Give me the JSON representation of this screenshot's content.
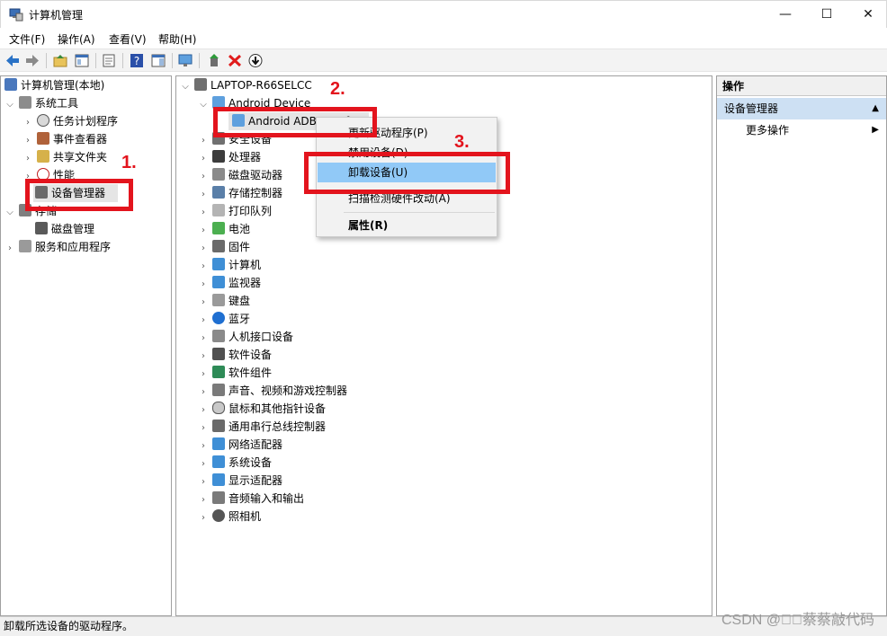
{
  "window": {
    "title": "计算机管理",
    "min_glyph": "—",
    "max_glyph": "☐",
    "close_glyph": "✕"
  },
  "menu": {
    "file": "文件(F)",
    "action": "操作(A)",
    "view": "查看(V)",
    "help": "帮助(H)"
  },
  "left_tree": {
    "root": "计算机管理(本地)",
    "system_tools": "系统工具",
    "task_scheduler": "任务计划程序",
    "event_viewer": "事件查看器",
    "shared_folders": "共享文件夹",
    "performance": "性能",
    "device_manager": "设备管理器",
    "storage": "存储",
    "disk_management": "磁盘管理",
    "services_apps": "服务和应用程序"
  },
  "device_tree": {
    "computer": "LAPTOP-R66SELCC",
    "android_device": "Android Device",
    "adb_interface": "Android ADB Interface",
    "categories": [
      "安全设备",
      "处理器",
      "磁盘驱动器",
      "存储控制器",
      "打印队列",
      "电池",
      "固件",
      "计算机",
      "监视器",
      "键盘",
      "蓝牙",
      "人机接口设备",
      "软件设备",
      "软件组件",
      "声音、视频和游戏控制器",
      "鼠标和其他指针设备",
      "通用串行总线控制器",
      "网络适配器",
      "系统设备",
      "显示适配器",
      "音频输入和输出",
      "照相机"
    ]
  },
  "context_menu": {
    "update_driver": "更新驱动程序(P)",
    "disable_device": "禁用设备(D)",
    "uninstall_device": "卸载设备(U)",
    "scan_hardware": "扫描检测硬件改动(A)",
    "properties": "属性(R)"
  },
  "actions_pane": {
    "header": "操作",
    "section": "设备管理器",
    "more": "更多操作"
  },
  "annotations": {
    "step1": "1.",
    "step2": "2.",
    "step3": "3."
  },
  "status": {
    "text": "卸载所选设备的驱动程序。"
  },
  "watermark": "CSDN @\u0000\u0000蔡蔡敲代码",
  "colors": {
    "annotation_red": "#e3141d",
    "menu_highlight": "#91c9f7",
    "section_blue": "#cde0f3"
  }
}
